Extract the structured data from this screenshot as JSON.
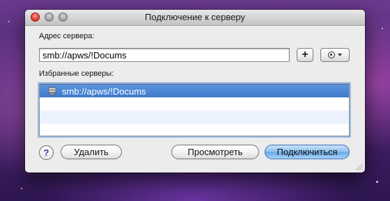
{
  "window": {
    "title": "Подключение к серверу"
  },
  "address": {
    "label": "Адрес сервера:",
    "value": "smb://apws/!Docums"
  },
  "favorites": {
    "label": "Избранные серверы:",
    "items": [
      {
        "label": "smb://apws/!Docums",
        "icon": "network-server-icon",
        "selected": true
      }
    ]
  },
  "buttons": {
    "add": "+",
    "help": "?",
    "delete": "Удалить",
    "browse": "Просмотреть",
    "connect": "Подключиться"
  },
  "colors": {
    "selection": "#3d78cb",
    "default_button": "#8fc0ef",
    "help_glyph": "#5a2aa0"
  }
}
